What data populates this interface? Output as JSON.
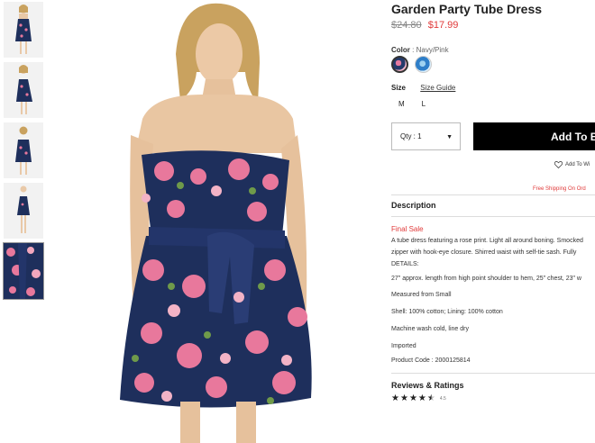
{
  "thumbnails": [
    {
      "label": "front view"
    },
    {
      "label": "side view"
    },
    {
      "label": "back view"
    },
    {
      "label": "full length"
    },
    {
      "label": "fabric detail"
    }
  ],
  "product": {
    "title": "Garden Party Tube Dress",
    "old_price": "$24.80",
    "new_price": "$17.99"
  },
  "color": {
    "label": "Color",
    "separator": ":",
    "value": "Navy/Pink"
  },
  "size": {
    "label": "Size",
    "guide_label": "Size Guide",
    "options": [
      "M",
      "L"
    ]
  },
  "qty": {
    "label": "Qty : 1",
    "caret": "▼"
  },
  "add_button": {
    "label": "Add To B"
  },
  "wishlist": {
    "label": "Add To Wi"
  },
  "shipping": {
    "label": "Free Shipping On Ord"
  },
  "description": {
    "heading": "Description",
    "final_sale": "Final Sale",
    "lines": [
      "A tube dress featuring a rose print. Light all around boning. Smocked",
      "zipper with hook-eye closure. Shirred waist with self-tie sash. Fully",
      "DETAILS:",
      "27\" approx. length from high point shoulder to hem, 25\" chest, 23\" w",
      "Measured from Small",
      "Shell: 100% cotton; Lining: 100% cotton",
      "Machine wash cold, line dry",
      "Imported",
      "Product Code : 2000125814"
    ]
  },
  "reviews": {
    "heading": "Reviews & Ratings",
    "rating": 4.5,
    "rating_label": "4.5"
  },
  "colors": {
    "accent": "#e03a3a",
    "button": "#000000",
    "dress_navy": "#1e2f5c",
    "rose_pink": "#e8789c"
  }
}
